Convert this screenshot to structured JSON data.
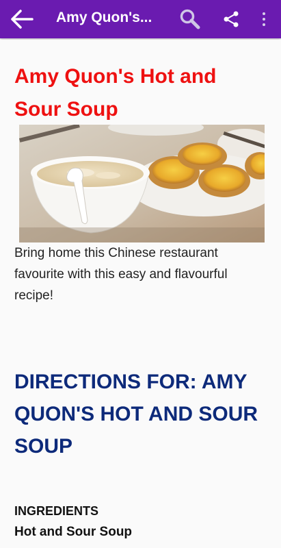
{
  "appbar": {
    "title": "Amy Quon's...",
    "icons": [
      "back-arrow-icon",
      "search-icon",
      "share-icon",
      "more-vert-icon"
    ]
  },
  "recipe": {
    "title": "Amy Quon's Hot and Sour Soup",
    "description": "Bring home this Chinese restaurant favourite with this easy and flavourful recipe!",
    "directions_heading": "DIRECTIONS FOR: AMY QUON'S HOT AND SOUR SOUP",
    "ingredients_label": "INGREDIENTS",
    "ingredients_section": "Hot and Sour Soup"
  },
  "colors": {
    "appbar": "#6a1bb0",
    "title": "#ee1111",
    "heading": "#0d2a7a"
  }
}
